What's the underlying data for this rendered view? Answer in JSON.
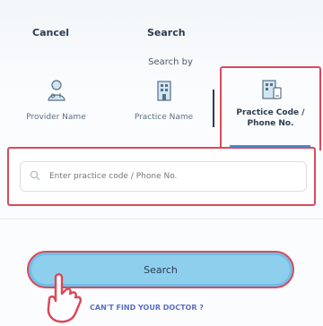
{
  "header": {
    "cancel_label": "Cancel",
    "title": "Search"
  },
  "search_by_label": "Search by",
  "tabs": [
    {
      "label": "Provider Name",
      "icon": "doctor-icon",
      "active": false
    },
    {
      "label": "Practice Name",
      "icon": "building-icon",
      "active": false
    },
    {
      "label_line1": "Practice Code /",
      "label_line2": "Phone No.",
      "icon": "practice-code-icon",
      "active": true
    }
  ],
  "search_input": {
    "placeholder": "Enter practice code / Phone No.",
    "value": ""
  },
  "search_button_label": "Search",
  "cant_find_label": "CAN'T FIND YOUR DOCTOR ?",
  "colors": {
    "accent": "#8ecfee",
    "highlight": "#d94a5a",
    "link": "#5b6fc2",
    "text": "#2d3b52"
  }
}
